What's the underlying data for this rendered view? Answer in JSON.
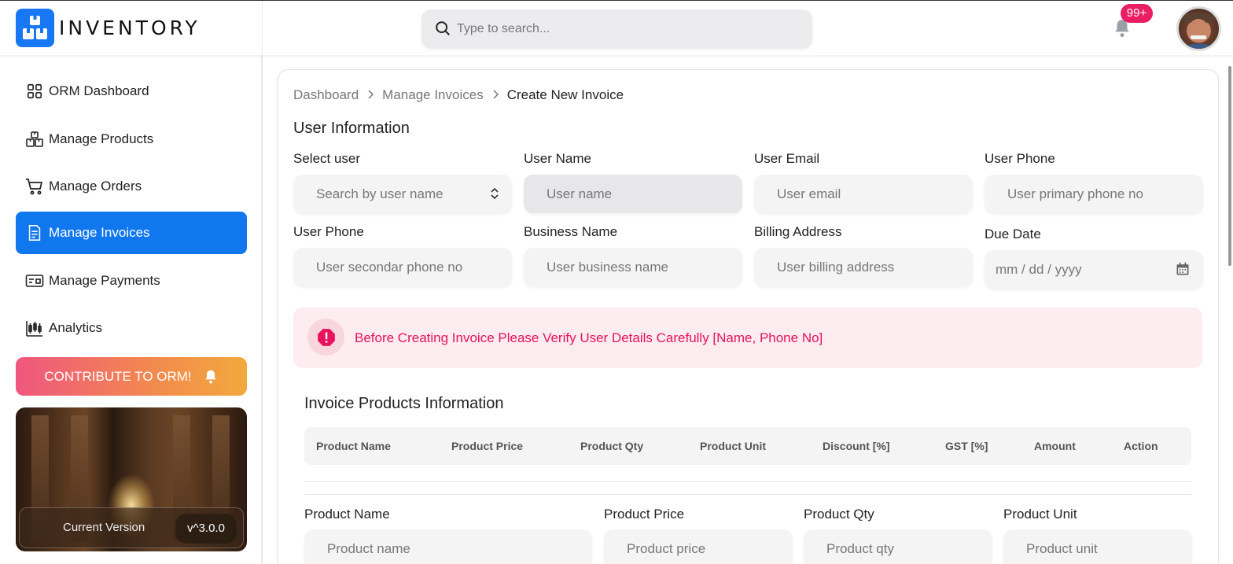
{
  "header": {
    "logo_text": "INVENTORY",
    "search_placeholder": "Type to search...",
    "notification_count": "99+"
  },
  "sidebar": {
    "items": [
      {
        "label": "ORM Dashboard",
        "icon": "grid-icon"
      },
      {
        "label": "Manage Products",
        "icon": "boxes-icon"
      },
      {
        "label": "Manage Orders",
        "icon": "cart-icon"
      },
      {
        "label": "Manage Invoices",
        "icon": "invoice-icon",
        "active": true
      },
      {
        "label": "Manage Payments",
        "icon": "payment-card-icon"
      },
      {
        "label": "Analytics",
        "icon": "analytics-icon"
      }
    ],
    "contribute_label": "CONTRIBUTE TO ORM!",
    "version_label": "Current Version",
    "version_value": "v^3.0.0"
  },
  "breadcrumb": [
    "Dashboard",
    "Manage Invoices",
    "Create New Invoice"
  ],
  "user_info": {
    "title": "User Information",
    "select_user": {
      "label": "Select user",
      "placeholder": "Search by user name"
    },
    "user_name": {
      "label": "User Name",
      "placeholder": "User name"
    },
    "user_email": {
      "label": "User Email",
      "placeholder": "User email"
    },
    "user_phone": {
      "label": "User Phone",
      "placeholder": "User primary phone no"
    },
    "user_phone_2": {
      "label": "User Phone",
      "placeholder": "User secondar phone no"
    },
    "business_name": {
      "label": "Business Name",
      "placeholder": "User business name"
    },
    "billing_address": {
      "label": "Billing Address",
      "placeholder": "User billing address"
    },
    "due_date": {
      "label": "Due Date",
      "placeholder": "mm / dd / yyyy"
    }
  },
  "alert": {
    "text": "Before Creating Invoice Please Verify User Details Carefully [Name, Phone No]",
    "color": "#e8125e"
  },
  "products": {
    "title": "Invoice Products Information",
    "columns": [
      "Product Name",
      "Product Price",
      "Product Qty",
      "Product Unit",
      "Discount [%]",
      "GST [%]",
      "Amount",
      "Action"
    ],
    "form": {
      "name": {
        "label": "Product Name",
        "placeholder": "Product name"
      },
      "price": {
        "label": "Product Price",
        "placeholder": "Product price"
      },
      "qty": {
        "label": "Product Qty",
        "placeholder": "Product qty"
      },
      "unit": {
        "label": "Product Unit",
        "placeholder": "Product unit"
      }
    }
  },
  "colors": {
    "accent": "#1177ee",
    "badge": "#e91e63"
  }
}
